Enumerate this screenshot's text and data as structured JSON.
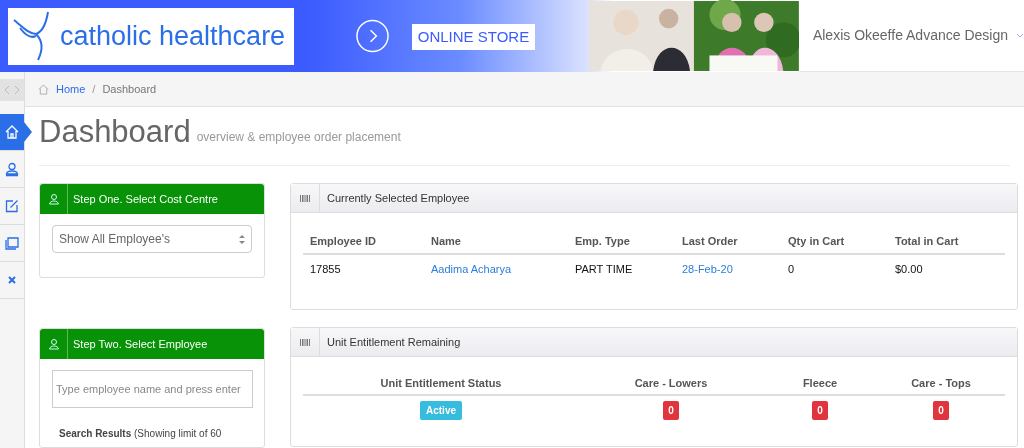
{
  "header": {
    "logo_text": "catholic healthcare",
    "store_button": "ONLINE STORE",
    "user_menu": "Alexis Okeeffe Advance Design"
  },
  "sidebar": {
    "items": [
      {
        "kind": "home",
        "selected": true
      },
      {
        "kind": "user",
        "selected": false
      },
      {
        "kind": "edit",
        "selected": false
      },
      {
        "kind": "cards",
        "selected": false
      },
      {
        "kind": "close",
        "selected": false
      }
    ]
  },
  "breadcrumb": [
    "Home",
    "/",
    "Dashboard"
  ],
  "page": {
    "title": "Dashboard",
    "subtitle": "overview & employee order placement"
  },
  "step_one": {
    "title": "Step One. Select Cost Centre",
    "select_value": "Show All Employee's"
  },
  "step_two": {
    "title": "Step Two. Select Employee",
    "placeholder": "Type employee name and press enter",
    "results_note": "**Search Results** (Showing limit of 60"
  },
  "selected_employee": {
    "title": "Currently Selected Employee",
    "columns": [
      "Employee ID",
      "Name",
      "Emp. Type",
      "Last Order",
      "Qty in Cart",
      "Total in Cart"
    ],
    "rows": [
      [
        {
          "text": "17855",
          "link": false
        },
        {
          "text": "Aadima Acharya",
          "link": true
        },
        {
          "text": "PART TIME",
          "link": false
        },
        {
          "text": "28-Feb-20",
          "link": true
        },
        {
          "text": "0",
          "link": false
        },
        {
          "text": "$0.00",
          "link": false
        }
      ]
    ]
  },
  "entitlement": {
    "title": "Unit Entitlement Remaining",
    "columns": [
      "Unit Entitlement Status",
      "Care - Lowers",
      "Fleece",
      "Care - Tops"
    ],
    "rows": [
      [
        {
          "text": "Active",
          "kind": "status"
        },
        {
          "text": "0",
          "kind": "count"
        },
        {
          "text": "0",
          "kind": "count"
        },
        {
          "text": "0",
          "kind": "count"
        }
      ]
    ]
  }
}
